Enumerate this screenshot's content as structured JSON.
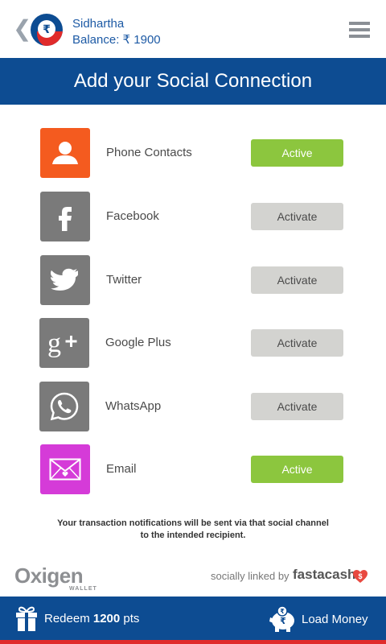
{
  "header": {
    "back_glyph": "❮",
    "logo_symbol": "₹",
    "user_name": "Sidhartha",
    "balance_label": "Balance:",
    "balance_value": "₹ 1900"
  },
  "title": "Add your Social Connection",
  "connections": [
    {
      "name": "Phone Contacts",
      "status": "Active",
      "icon": "contact-icon",
      "color": "#f45b1f"
    },
    {
      "name": "Facebook",
      "status": "Activate",
      "icon": "facebook-icon",
      "color": "#7a7a7a"
    },
    {
      "name": "Twitter",
      "status": "Activate",
      "icon": "twitter-icon",
      "color": "#7a7a7a"
    },
    {
      "name": "Google Plus",
      "status": "Activate",
      "icon": "google-plus-icon",
      "color": "#7a7a7a"
    },
    {
      "name": "WhatsApp",
      "status": "Activate",
      "icon": "whatsapp-icon",
      "color": "#7a7a7a"
    },
    {
      "name": "Email",
      "status": "Active",
      "icon": "email-icon",
      "color": "#d53bd8"
    }
  ],
  "note_line1": "Your transaction notifications will be sent via that social channel",
  "note_line2": "to the intended recipient.",
  "footer": {
    "oxigen": "Oxigen",
    "wallet": "WALLET",
    "socially_linked": "socially linked by",
    "fastacash": "fastacash"
  },
  "bottom": {
    "redeem_prefix": "Redeem",
    "redeem_points": "1200",
    "redeem_suffix": "pts",
    "load_money": "Load Money"
  },
  "colors": {
    "brand_blue": "#0d4c92",
    "active_green": "#8cc63e",
    "inactive_gray": "#d3d3d0",
    "accent_red": "#e02b2b"
  }
}
